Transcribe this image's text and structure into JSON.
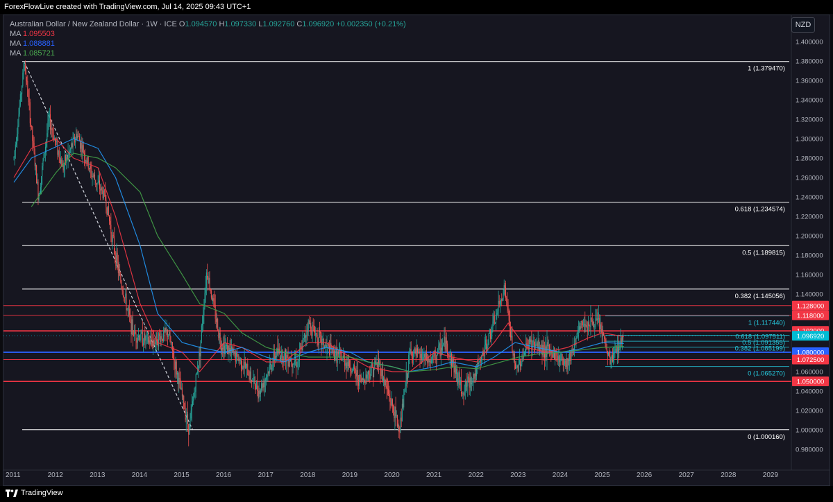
{
  "credit": "ForexFlowLive created with TradingView.com, Jul 14, 2025 09:43 UTC+1",
  "currency_button": "NZD",
  "legend": {
    "symbol": "Australian Dollar / New Zealand Dollar · 1W · ICE",
    "open_label": "O",
    "open": "1.094570",
    "high_label": "H",
    "high": "1.097330",
    "low_label": "L",
    "low": "1.092760",
    "close_label": "C",
    "close": "1.096920",
    "change": "+0.002350 (+0.21%)",
    "ma": [
      {
        "label": "MA",
        "value": "1.095503",
        "color": "#f23645"
      },
      {
        "label": "MA",
        "value": "1.088881",
        "color": "#2962ff"
      },
      {
        "label": "MA",
        "value": "1.085721",
        "color": "#4caf50"
      }
    ]
  },
  "footer_brand": "TradingView",
  "colors": {
    "up": "#26a69a",
    "down": "#ef5350",
    "fib": "#ffffff",
    "fib_lower": "#26c6da",
    "ma_red": "#f23645",
    "ma_blue": "#2196f3",
    "ma_green": "#43a047",
    "level_red": "#f23645",
    "level_blue": "#2962ff",
    "price_tag": "#00bcd4"
  },
  "chart_data": {
    "type": "candlestick",
    "ylim": [
      0.97,
      1.4
    ],
    "x_range": [
      "2011-01",
      "2029-09"
    ],
    "y_ticks": [
      "1.400000",
      "1.380000",
      "1.360000",
      "1.340000",
      "1.320000",
      "1.300000",
      "1.280000",
      "1.260000",
      "1.240000",
      "1.220000",
      "1.200000",
      "1.180000",
      "1.160000",
      "1.140000",
      "1.120000",
      "1.100000",
      "1.080000",
      "1.060000",
      "1.040000",
      "1.020000",
      "1.000000",
      "0.980000"
    ],
    "x_ticks": [
      "2011",
      "2012",
      "2013",
      "2014",
      "2015",
      "2016",
      "2017",
      "2018",
      "2019",
      "2020",
      "2021",
      "2022",
      "2023",
      "2024",
      "2025",
      "2026",
      "2027",
      "2028",
      "2029"
    ],
    "price_path": [
      [
        "2011-01",
        1.28
      ],
      [
        "2011-04",
        1.379
      ],
      [
        "2011-08",
        1.24
      ],
      [
        "2011-11",
        1.32
      ],
      [
        "2012-03",
        1.27
      ],
      [
        "2012-07",
        1.305
      ],
      [
        "2012-11",
        1.265
      ],
      [
        "2013-03",
        1.24
      ],
      [
        "2013-07",
        1.16
      ],
      [
        "2013-11",
        1.1
      ],
      [
        "2014-04",
        1.09
      ],
      [
        "2014-09",
        1.1
      ],
      [
        "2015-03",
        1.001
      ],
      [
        "2015-06",
        1.08
      ],
      [
        "2015-08",
        1.165
      ],
      [
        "2015-12",
        1.09
      ],
      [
        "2016-06",
        1.07
      ],
      [
        "2016-11",
        1.04
      ],
      [
        "2017-04",
        1.08
      ],
      [
        "2017-10",
        1.07
      ],
      [
        "2018-01",
        1.11
      ],
      [
        "2018-06",
        1.085
      ],
      [
        "2018-12",
        1.07
      ],
      [
        "2019-04",
        1.05
      ],
      [
        "2019-09",
        1.07
      ],
      [
        "2020-03",
        1.0
      ],
      [
        "2020-06",
        1.08
      ],
      [
        "2020-12",
        1.07
      ],
      [
        "2021-04",
        1.09
      ],
      [
        "2021-09",
        1.04
      ],
      [
        "2022-01",
        1.06
      ],
      [
        "2022-06",
        1.11
      ],
      [
        "2022-09",
        1.148
      ],
      [
        "2022-12",
        1.06
      ],
      [
        "2023-04",
        1.09
      ],
      [
        "2023-10",
        1.08
      ],
      [
        "2024-03",
        1.07
      ],
      [
        "2024-07",
        1.11
      ],
      [
        "2024-12",
        1.11
      ],
      [
        "2025-03",
        1.07
      ],
      [
        "2025-07",
        1.097
      ]
    ],
    "series": [
      {
        "name": "MA",
        "last_value": 1.095503,
        "color": "#f23645",
        "points": [
          [
            "2011-01",
            1.26
          ],
          [
            "2011-06",
            1.29
          ],
          [
            "2012-01",
            1.3
          ],
          [
            "2012-06",
            1.28
          ],
          [
            "2013-01",
            1.27
          ],
          [
            "2013-06",
            1.22
          ],
          [
            "2014-01",
            1.13
          ],
          [
            "2014-06",
            1.09
          ],
          [
            "2015-01",
            1.08
          ],
          [
            "2015-06",
            1.06
          ],
          [
            "2016-01",
            1.09
          ],
          [
            "2016-06",
            1.085
          ],
          [
            "2017-01",
            1.07
          ],
          [
            "2017-06",
            1.07
          ],
          [
            "2018-01",
            1.09
          ],
          [
            "2018-06",
            1.09
          ],
          [
            "2019-01",
            1.075
          ],
          [
            "2019-06",
            1.065
          ],
          [
            "2020-01",
            1.06
          ],
          [
            "2020-06",
            1.06
          ],
          [
            "2021-01",
            1.08
          ],
          [
            "2021-06",
            1.075
          ],
          [
            "2022-01",
            1.07
          ],
          [
            "2022-06",
            1.09
          ],
          [
            "2022-10",
            1.11
          ],
          [
            "2023-03",
            1.085
          ],
          [
            "2023-09",
            1.08
          ],
          [
            "2024-03",
            1.085
          ],
          [
            "2024-09",
            1.095
          ],
          [
            "2025-01",
            1.1
          ],
          [
            "2025-07",
            1.096
          ]
        ]
      },
      {
        "name": "MA",
        "last_value": 1.088881,
        "color": "#2196f3",
        "points": [
          [
            "2011-01",
            1.255
          ],
          [
            "2011-06",
            1.28
          ],
          [
            "2012-06",
            1.3
          ],
          [
            "2013-01",
            1.29
          ],
          [
            "2013-06",
            1.26
          ],
          [
            "2014-01",
            1.19
          ],
          [
            "2014-06",
            1.12
          ],
          [
            "2015-01",
            1.09
          ],
          [
            "2015-06",
            1.085
          ],
          [
            "2016-01",
            1.08
          ],
          [
            "2016-06",
            1.085
          ],
          [
            "2017-01",
            1.075
          ],
          [
            "2017-06",
            1.07
          ],
          [
            "2018-01",
            1.08
          ],
          [
            "2018-06",
            1.085
          ],
          [
            "2019-01",
            1.08
          ],
          [
            "2019-06",
            1.07
          ],
          [
            "2020-01",
            1.065
          ],
          [
            "2020-06",
            1.06
          ],
          [
            "2021-01",
            1.065
          ],
          [
            "2021-06",
            1.07
          ],
          [
            "2022-01",
            1.065
          ],
          [
            "2022-06",
            1.075
          ],
          [
            "2022-12",
            1.09
          ],
          [
            "2023-06",
            1.085
          ],
          [
            "2024-01",
            1.08
          ],
          [
            "2024-06",
            1.083
          ],
          [
            "2025-01",
            1.09
          ],
          [
            "2025-07",
            1.089
          ]
        ]
      },
      {
        "name": "MA",
        "last_value": 1.085721,
        "color": "#43a047",
        "points": [
          [
            "2011-06",
            1.23
          ],
          [
            "2012-01",
            1.265
          ],
          [
            "2012-06",
            1.285
          ],
          [
            "2013-01",
            1.28
          ],
          [
            "2013-06",
            1.27
          ],
          [
            "2014-01",
            1.245
          ],
          [
            "2014-06",
            1.2
          ],
          [
            "2015-01",
            1.16
          ],
          [
            "2015-06",
            1.13
          ],
          [
            "2016-01",
            1.12
          ],
          [
            "2016-06",
            1.1
          ],
          [
            "2017-01",
            1.085
          ],
          [
            "2017-06",
            1.08
          ],
          [
            "2018-01",
            1.075
          ],
          [
            "2018-06",
            1.075
          ],
          [
            "2019-01",
            1.075
          ],
          [
            "2019-06",
            1.07
          ],
          [
            "2020-01",
            1.065
          ],
          [
            "2020-06",
            1.06
          ],
          [
            "2021-01",
            1.062
          ],
          [
            "2021-06",
            1.065
          ],
          [
            "2022-01",
            1.063
          ],
          [
            "2022-06",
            1.068
          ],
          [
            "2023-01",
            1.075
          ],
          [
            "2023-06",
            1.078
          ],
          [
            "2024-01",
            1.08
          ],
          [
            "2024-06",
            1.082
          ],
          [
            "2025-01",
            1.085
          ],
          [
            "2025-07",
            1.086
          ]
        ]
      }
    ],
    "fibonacci_upper": [
      {
        "label": "1 (1.379470)",
        "value": 1.37947
      },
      {
        "label": "0.618 (1.234574)",
        "value": 1.234574
      },
      {
        "label": "0.5 (1.189815)",
        "value": 1.189815
      },
      {
        "label": "0.382 (1.145056)",
        "value": 1.145056
      },
      {
        "label": "0 (1.000160)",
        "value": 1.00016
      }
    ],
    "fibonacci_lower": [
      {
        "label": "1 (1.117440)",
        "value": 1.11744
      },
      {
        "label": "0.618 (1.097511)",
        "value": 1.097511
      },
      {
        "label": "0.5 (1.091355)",
        "value": 1.091355
      },
      {
        "label": "0.382 (1.085199)",
        "value": 1.085199
      },
      {
        "label": "0 (1.065270)",
        "value": 1.06527
      }
    ],
    "horizontal_levels": [
      {
        "label": "1.128000",
        "value": 1.128,
        "color": "#f23645"
      },
      {
        "label": "1.118000",
        "value": 1.118,
        "color": "#f23645"
      },
      {
        "label": "1.102000",
        "value": 1.102,
        "color": "#f23645"
      },
      {
        "label": "1.080000",
        "value": 1.08,
        "color": "#2962ff"
      },
      {
        "label": "1.072500",
        "value": 1.0725,
        "color": "#f23645"
      },
      {
        "label": "1.050000",
        "value": 1.05,
        "color": "#f23645"
      }
    ],
    "last_price": {
      "label": "1.096920",
      "value": 1.09692
    },
    "trendline": [
      [
        "2011-04",
        1.379
      ],
      [
        "2015-04",
        1.0
      ]
    ],
    "grid": false
  }
}
